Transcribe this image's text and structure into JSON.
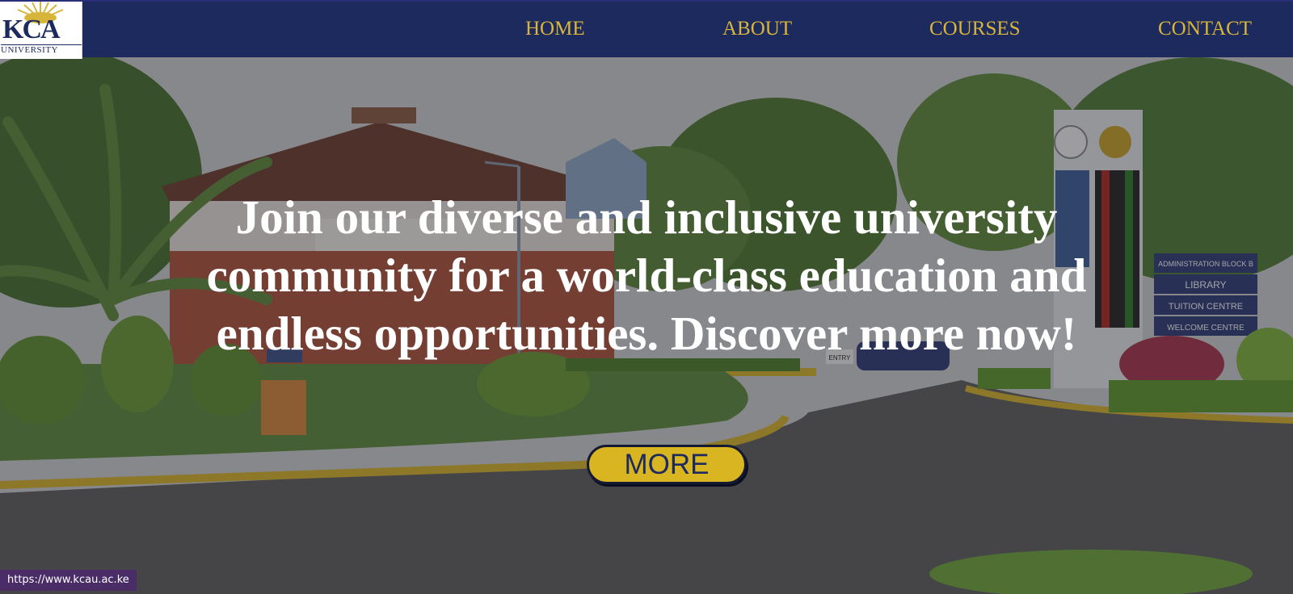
{
  "header": {
    "logo": {
      "title": "KCA",
      "subtitle": "UNIVERSITY"
    },
    "nav": [
      {
        "label": "HOME"
      },
      {
        "label": "ABOUT"
      },
      {
        "label": "COURSES"
      },
      {
        "label": "CONTACT"
      }
    ]
  },
  "hero": {
    "heading": "Join our diverse and inclusive university community for a world-class education and endless opportunities. Discover more now!",
    "cta_label": "MORE",
    "signs": [
      "ADMINISTRATION BLOCK B",
      "LIBRARY",
      "TUITION CENTRE",
      "WELCOME CENTRE"
    ],
    "entry_sign": "ENTRY"
  },
  "status_bar": {
    "url": "https://www.kcau.ac.ke"
  },
  "colors": {
    "navbar": "#1c2a5e",
    "accent_gold": "#d9b63a",
    "button_gold": "#d9b522",
    "status_bg": "#4a2d67"
  }
}
